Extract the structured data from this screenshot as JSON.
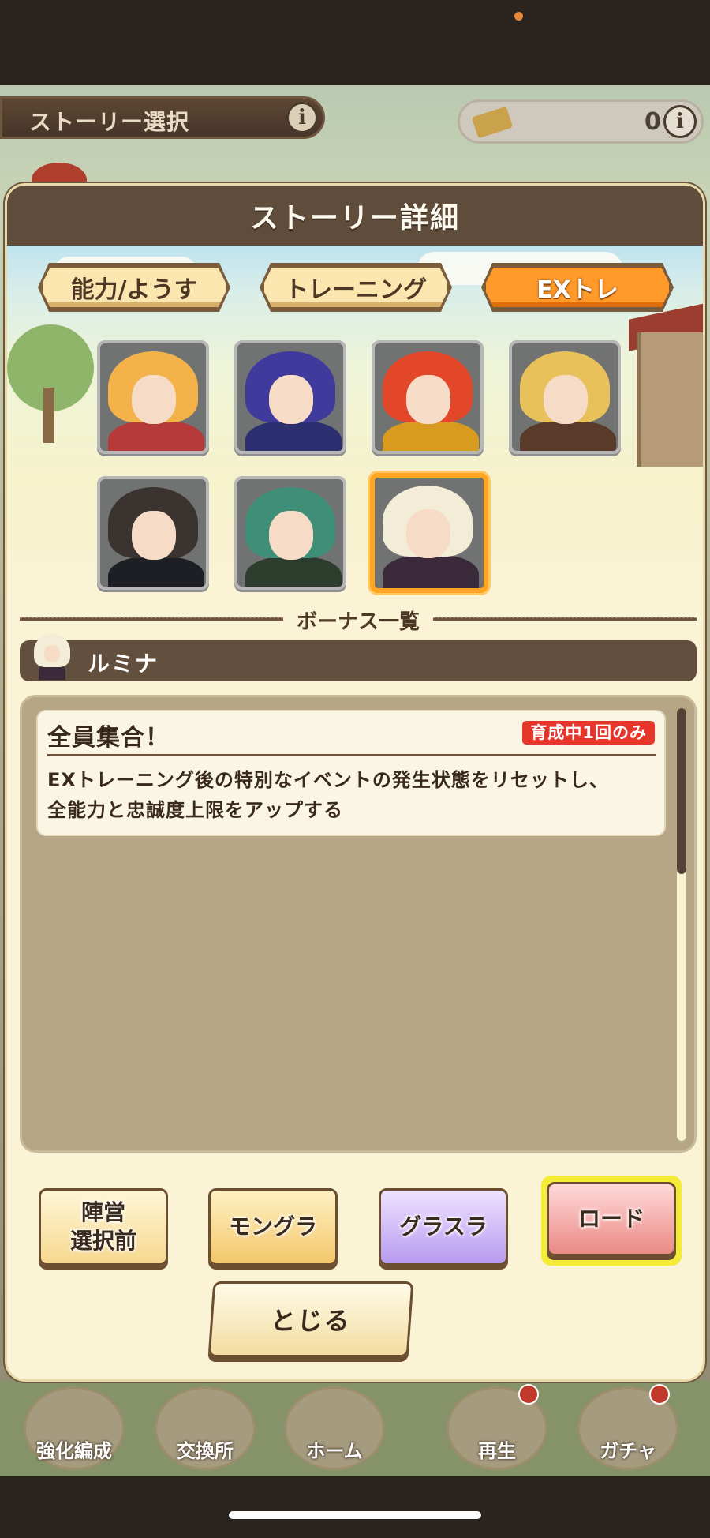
{
  "background": {
    "screen_title": "ストーリー選択",
    "ticket_count": "0",
    "info_icon": "i",
    "nav": [
      {
        "label": "強化編成"
      },
      {
        "label": "交換所"
      },
      {
        "label": "ホーム"
      },
      {
        "label": "再生"
      },
      {
        "label": "ガチャ"
      }
    ]
  },
  "modal": {
    "title": "ストーリー詳細",
    "tabs": [
      {
        "label": "能力/ようす",
        "active": false
      },
      {
        "label": "トレーニング",
        "active": false
      },
      {
        "label": "EXトレ",
        "active": true
      }
    ],
    "characters": [
      {
        "hair": "#f4b24a",
        "body": "#b63a3a",
        "selected": false
      },
      {
        "hair": "#3f3a9c",
        "body": "#2c2f6f",
        "selected": false
      },
      {
        "hair": "#e2472a",
        "body": "#d89b1e",
        "selected": false
      },
      {
        "hair": "#e8c15a",
        "body": "#5a3a2a",
        "selected": false
      },
      {
        "hair": "#3a3330",
        "body": "#1e1f25",
        "selected": false
      },
      {
        "hair": "#3f8f78",
        "body": "#2c3d2e",
        "selected": false
      },
      {
        "hair": "#f3ecd6",
        "body": "#3a2a3a",
        "selected": true
      }
    ],
    "bonus_section_label": "ボーナス一覧",
    "selected_character_name": "ルミナ",
    "bonus": {
      "title": "全員集合！",
      "badge": "育成中1回のみ",
      "description_line1": "EXトレーニング後の特別なイベントの発生状態をリセットし、",
      "description_line2": "全能力と忠誠度上限をアップする"
    },
    "scroll_position": 0,
    "buttons": {
      "camp_line1": "陣営",
      "camp_line2": "選択前",
      "mongura": "モングラ",
      "gurasura": "グラスラ",
      "load": "ロード",
      "close": "とじる"
    }
  },
  "colors": {
    "accent_orange": "#ff9a2b",
    "header_brown": "#5f4c3a",
    "badge_red": "#e6352b",
    "highlight_yellow": "#f5ec3a"
  }
}
